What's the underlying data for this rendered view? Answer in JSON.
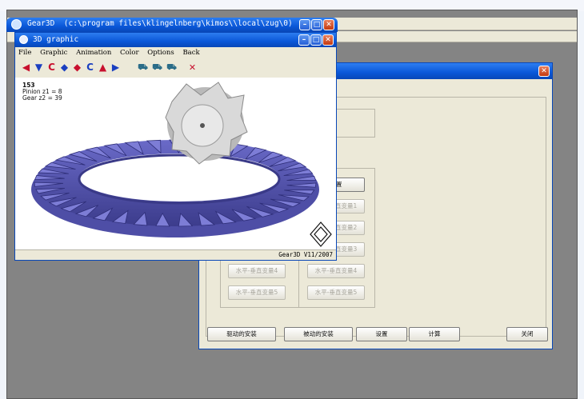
{
  "gear3d_window": {
    "title": "Gear3D  (c:\\program files\\klingelnberg\\kimos\\\\local\\zug\\0)"
  },
  "graphic_window": {
    "title": "3D graphic",
    "menu": [
      "File",
      "Graphic",
      "Animation",
      "Color",
      "Options",
      "Back"
    ],
    "info": {
      "number": "153",
      "pinion": "Pinion  z1 =  8",
      "gear": "Gear   z2 =  39"
    },
    "status": "Gear3D  V11/2007"
  },
  "dialog": {
    "buttons_right": [
      "设置",
      "水平-垂直变量1",
      "水平-垂直变量2",
      "水平-垂直变量3",
      "水平-垂直变量4",
      "水平-垂直变量5"
    ],
    "buttons_left": [
      "水平-垂直变量4",
      "水平-垂直变量5"
    ],
    "bottom_buttons": [
      "驱动的安装",
      "被动的安装",
      "设置",
      "计算",
      "关闭"
    ]
  },
  "colors": {
    "gear_fill": "#5a5ab4",
    "pinion_fill": "#dcdcdc",
    "title_blue": "#0a57d8"
  }
}
